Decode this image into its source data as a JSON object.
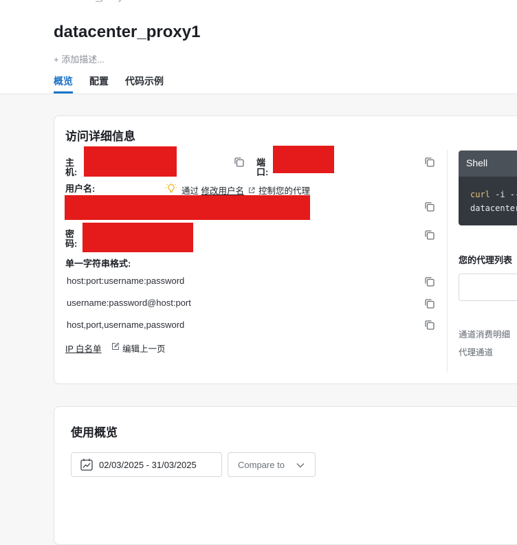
{
  "header": {
    "breadcrumb": "datacenter_proxy",
    "title": "datacenter_proxy1",
    "add_description": "+ 添加描述...",
    "tabs": [
      {
        "label": "概览",
        "active": true
      },
      {
        "label": "配置",
        "active": false
      },
      {
        "label": "代码示例",
        "active": false
      }
    ]
  },
  "access_details": {
    "title": "访问详细信息",
    "host_label": "主\n机:",
    "port_label": "端\n口:",
    "username_label": "用户名:",
    "password_label": "密\n码:",
    "username_hint": {
      "prefix": "通过",
      "link": "修改用户名",
      "suffix": "控制您的代理"
    },
    "string_format_label": "单一字符串格式:",
    "formats": [
      "host:port:username:password",
      "username:password@host:port",
      "host,port,username,password"
    ],
    "ip_whitelist_link": "IP 白名单",
    "edit_previous_link": "编辑上一页"
  },
  "shell": {
    "title": "Shell",
    "code_line1_cmd": "curl",
    "code_line1_rest": " -i --",
    "code_line2": "datacenter"
  },
  "side": {
    "proxy_list_title": "您的代理列表",
    "channel_usage_link": "通道消费明细",
    "proxy_channel_link": "代理通道"
  },
  "usage": {
    "title": "使用概览",
    "date_range": "02/03/2025 - 31/03/2025",
    "compare_label": "Compare to"
  },
  "colors": {
    "accent": "#1a73c9",
    "redaction": "#e51b1b",
    "hint_bulb": "#f2b01e"
  }
}
